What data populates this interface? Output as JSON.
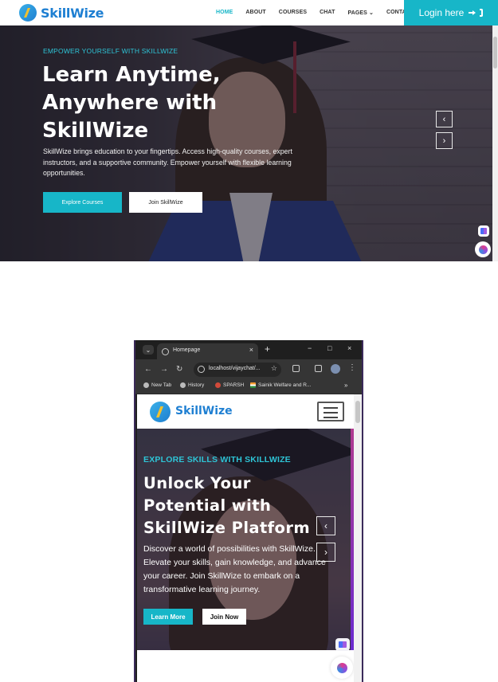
{
  "desktop": {
    "brand": "SkillWize",
    "nav_items": [
      {
        "label": "HOME",
        "active": true
      },
      {
        "label": "ABOUT",
        "active": false
      },
      {
        "label": "COURSES",
        "active": false
      },
      {
        "label": "CHAT",
        "active": false
      },
      {
        "label": "PAGES",
        "active": false
      },
      {
        "label": "CONTACT",
        "active": false
      }
    ],
    "login_label": "Login here",
    "hero": {
      "kicker": "EMPOWER YOURSELF WITH SKILLWIZE",
      "title": "Learn Anytime, Anywhere with SkillWize",
      "description": "SkillWize brings education to your fingertips. Access high-quality courses, expert instructors, and a supportive community. Empower yourself with flexible learning opportunities.",
      "primary_button": "Explore Courses",
      "secondary_button": "Join SkillWize",
      "prev_arrow": "‹",
      "next_arrow": "›"
    }
  },
  "mobile": {
    "browser": {
      "tab_title": "Homepage",
      "url": "localhost/vijaychat/...",
      "bookmarks": [
        "New Tab",
        "History",
        "SPARSH",
        "Sainik Welfare and R..."
      ],
      "more": "»"
    },
    "brand": "SkillWize",
    "hero": {
      "kicker": "EXPLORE SKILLS WITH SKILLWIZE",
      "title_lines": [
        "Unlock Your",
        "Potential with",
        "SkillWize Platform"
      ],
      "description": "Discover a world of possibilities with SkillWize. Elevate your skills, gain knowledge, and advance your career. Join SkillWize to embark on a transformative learning journey.",
      "primary_button": "Learn More",
      "secondary_button": "Join Now",
      "prev_arrow": "‹",
      "next_arrow": "›"
    }
  },
  "colors": {
    "accent": "#17b6c8",
    "brand_text": "#1e7fd2"
  }
}
